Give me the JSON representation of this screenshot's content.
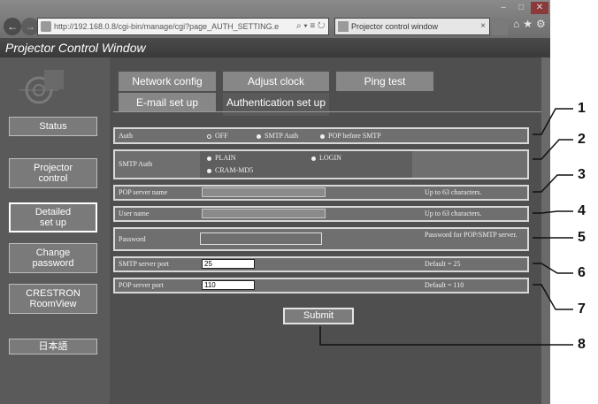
{
  "browser": {
    "address": "http://192.168.0.8/cgi-bin/manage/cgi?page_AUTH_SETTING.e",
    "address_tools": "⌕ ▾ ≡ ↻ ✕",
    "tab_title": "Projector control window",
    "tab_close": "×",
    "minimize": "–",
    "maximize": "□",
    "close": "✕",
    "right_icons": "⌂★⚙"
  },
  "app_title": "Projector Control Window",
  "sidebar": {
    "items": [
      {
        "label": "Status"
      },
      {
        "label": "Projector control"
      },
      {
        "label": "Detailed set up"
      },
      {
        "label": "Change password"
      },
      {
        "label": "CRESTRON RoomView"
      },
      {
        "label": "日本語"
      }
    ]
  },
  "tabs": {
    "row1": [
      "Network config",
      "Adjust clock",
      "Ping test"
    ],
    "row2": [
      "E-mail set up",
      "Authentication set up"
    ]
  },
  "form": {
    "auth": {
      "label": "Auth",
      "options": [
        "OFF",
        "SMTP Auth",
        "POP before SMTP"
      ],
      "selected": "OFF"
    },
    "smtp_auth": {
      "label": "SMTP Auth",
      "options": [
        "PLAIN",
        "LOGIN",
        "CRAM-MD5"
      ]
    },
    "pop_server_name": {
      "label": "POP server name",
      "value": "",
      "note": "Up to 63 characters."
    },
    "user_name": {
      "label": "User name",
      "value": "",
      "note": "Up to 63 characters."
    },
    "password": {
      "label": "Password",
      "value": "",
      "note": "Password for POP/SMTP server."
    },
    "smtp_server_port": {
      "label": "SMTP server port",
      "value": "25",
      "note": "Default = 25"
    },
    "pop_server_port": {
      "label": "POP server port",
      "value": "110",
      "note": "Default = 110"
    },
    "submit_label": "Submit"
  },
  "callouts": [
    "1",
    "2",
    "3",
    "4",
    "5",
    "6",
    "7",
    "8"
  ]
}
